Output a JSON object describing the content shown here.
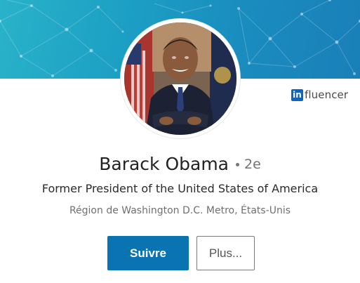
{
  "profile": {
    "name": "Barack Obama",
    "connection_degree": "2e",
    "headline": "Former President of the United States of America",
    "location": "Région de Washington D.C. Metro, États-Unis"
  },
  "badge": {
    "icon_text": "in",
    "label": "fluencer",
    "icon": "influencer-badge-icon"
  },
  "actions": {
    "follow_label": "Suivre",
    "more_label": "Plus..."
  },
  "colors": {
    "banner_start": "#29b2c9",
    "banner_end": "#1a7fb8",
    "primary_button": "#0a73b1",
    "influencer_blue": "#0a66c2"
  }
}
